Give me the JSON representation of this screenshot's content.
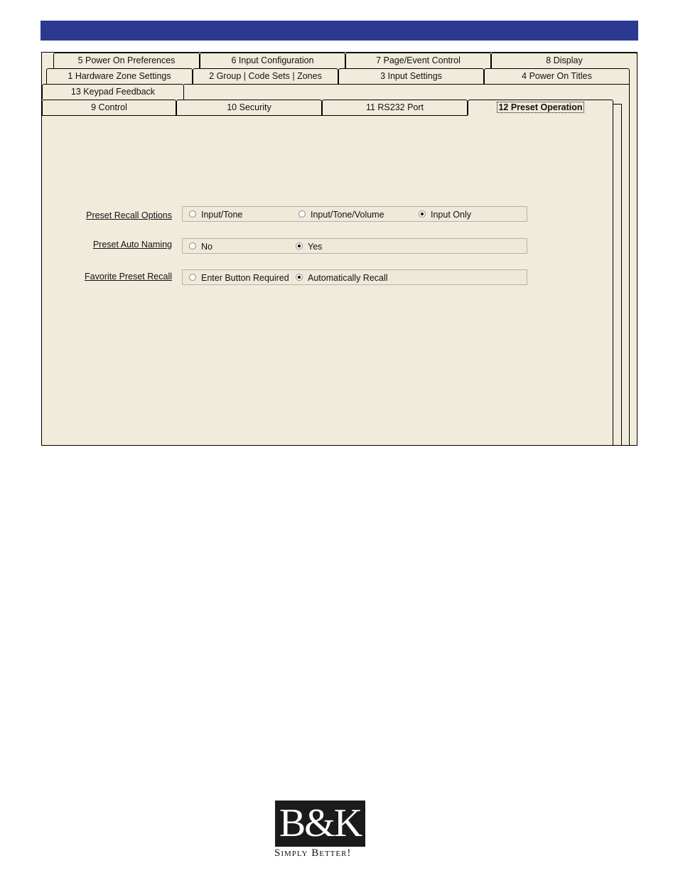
{
  "header": {
    "bar_color": "#2b3990"
  },
  "tabs": {
    "row1": [
      "5  Power On Preferences",
      "6  Input Configuration",
      "7  Page/Event Control",
      "8  Display"
    ],
    "row2": [
      "1  Hardware Zone Settings",
      "2  Group | Code Sets | Zones",
      "3  Input Settings",
      "4  Power On Titles"
    ],
    "row3": [
      "13 Keypad Feedback"
    ],
    "row4": [
      "9  Control",
      "10  Security",
      "11  RS232 Port",
      "12  Preset Operation"
    ]
  },
  "options": {
    "preset_recall": {
      "label": "Preset Recall Options",
      "choices": [
        "Input/Tone",
        "Input/Tone/Volume",
        "Input Only"
      ],
      "selected": "Input Only"
    },
    "auto_naming": {
      "label": "Preset Auto Naming",
      "choices": [
        "No",
        "Yes"
      ],
      "selected": "Yes"
    },
    "favorite_recall": {
      "label": "Favorite Preset Recall",
      "choices": [
        "Enter Button Required",
        "Automatically Recall"
      ],
      "selected": "Automatically Recall"
    }
  },
  "logo": {
    "text": "B&K",
    "tagline": "Simply Better!"
  }
}
